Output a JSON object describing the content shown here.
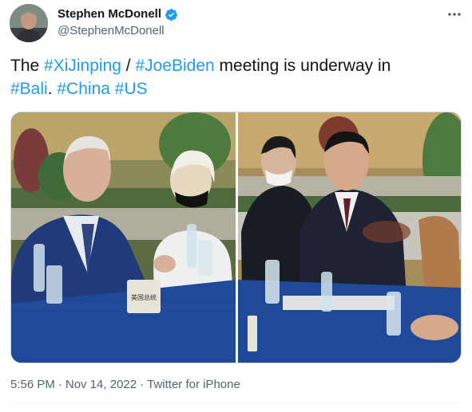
{
  "author": {
    "display_name": "Stephen McDonell",
    "handle": "@StephenMcDonell",
    "verified": true
  },
  "tweet": {
    "text_parts": {
      "p1": "The ",
      "tag1": "#XiJinping",
      "p2": " / ",
      "tag2": "#JoeBiden",
      "p3": " meeting is underway in ",
      "tag3": "#Bali",
      "p4": ". ",
      "tag4": "#China",
      "p5": " ",
      "tag5": "#US"
    }
  },
  "meta": {
    "time": "5:56 PM",
    "separator": "·",
    "date": "Nov 14, 2022",
    "source": "Twitter for iPhone"
  },
  "media": {
    "placard_text": "美国总统"
  },
  "colors": {
    "hashtag": "#1d9bf0",
    "verified": "#1d9bf0",
    "secondary_text": "#536471"
  },
  "icons": [
    "verified-badge-icon",
    "more-options-icon"
  ]
}
